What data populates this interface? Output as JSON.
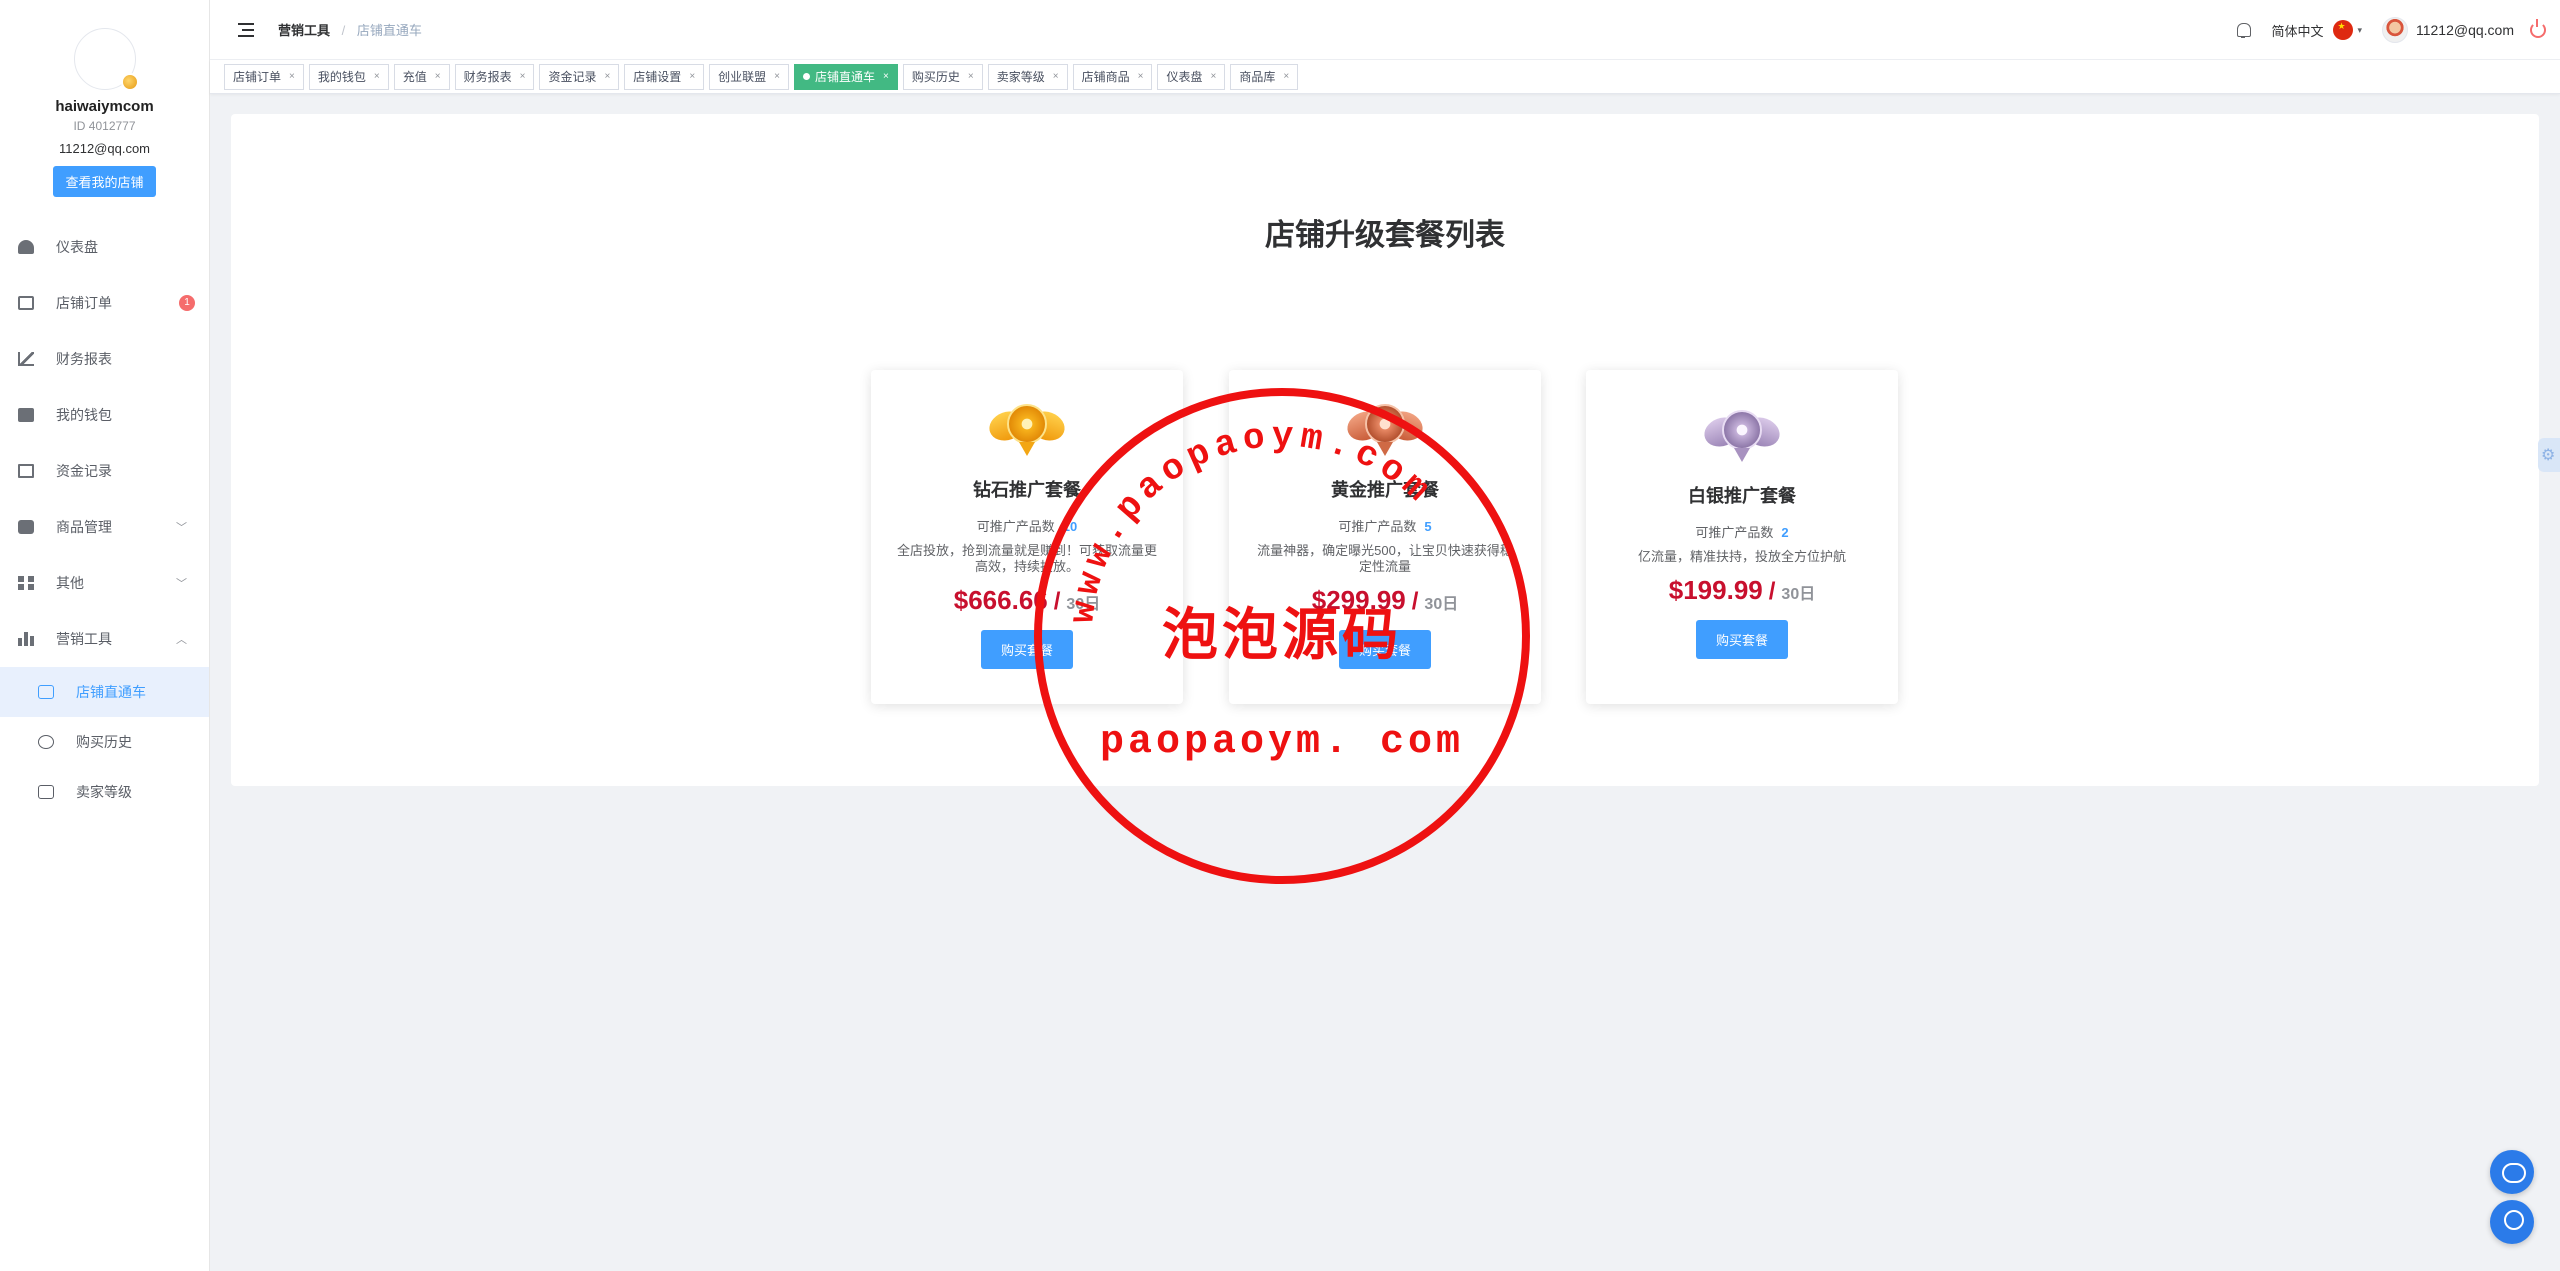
{
  "user": {
    "name": "haiwaiymcom",
    "id": "ID 4012777",
    "email": "11212@qq.com",
    "shop_button": "查看我的店铺"
  },
  "sidebar": {
    "items": [
      {
        "label": "仪表盘",
        "icon": "dashboard-icon"
      },
      {
        "label": "店铺订单",
        "icon": "clipboard-icon",
        "badge": "1"
      },
      {
        "label": "财务报表",
        "icon": "chart-icon"
      },
      {
        "label": "我的钱包",
        "icon": "wallet-icon"
      },
      {
        "label": "资金记录",
        "icon": "document-icon"
      },
      {
        "label": "商品管理",
        "icon": "bag-icon",
        "arrow": "﹀"
      },
      {
        "label": "其他",
        "icon": "grid-icon",
        "arrow": "﹀"
      },
      {
        "label": "营销工具",
        "icon": "bar-chart-icon",
        "arrow": "︿"
      }
    ],
    "sub_items": [
      {
        "label": "店铺直通车",
        "icon": "truck-icon"
      },
      {
        "label": "购买历史",
        "icon": "clock-icon"
      },
      {
        "label": "卖家等级",
        "icon": "upgrade-icon"
      }
    ]
  },
  "header": {
    "breadcrumb": [
      "营销工具",
      "店铺直通车"
    ],
    "breadcrumb_sep": "/",
    "language": "简体中文",
    "caret": "▾",
    "user_email": "11212@qq.com"
  },
  "tags": [
    {
      "label": "店铺订单",
      "active": false
    },
    {
      "label": "我的钱包",
      "active": false
    },
    {
      "label": "充值",
      "active": false
    },
    {
      "label": "财务报表",
      "active": false
    },
    {
      "label": "资金记录",
      "active": false
    },
    {
      "label": "店铺设置",
      "active": false
    },
    {
      "label": "创业联盟",
      "active": false
    },
    {
      "label": "店铺直通车",
      "active": true
    },
    {
      "label": "购买历史",
      "active": false
    },
    {
      "label": "卖家等级",
      "active": false
    },
    {
      "label": "店铺商品",
      "active": false
    },
    {
      "label": "仪表盘",
      "active": false
    },
    {
      "label": "商品库",
      "active": false
    }
  ],
  "tag_close": "×",
  "main": {
    "title": "店铺升级套餐列表",
    "cards": [
      {
        "medal": "gold-medal-icon",
        "title": "钻石推广套餐",
        "count_label": "可推广产品数",
        "count": "10",
        "desc": "全店投放，抢到流量就是赚到！可获取流量更高效，持续投放。",
        "price": "$666.66",
        "slash": "/",
        "period": "30日",
        "button": "购买套餐"
      },
      {
        "medal": "bronze-medal-icon",
        "title": "黄金推广套餐",
        "count_label": "可推广产品数",
        "count": "5",
        "desc": "流量神器，确定曝光500，让宝贝快速获得稳定性流量",
        "price": "$299.99",
        "slash": "/",
        "period": "30日",
        "button": "购买套餐"
      },
      {
        "medal": "silver-medal-icon",
        "title": "白银推广套餐",
        "count_label": "可推广产品数",
        "count": "2",
        "desc": "亿流量，精准扶持，投放全方位护航",
        "price": "$199.99",
        "slash": "/",
        "period": "30日",
        "button": "购买套餐"
      }
    ]
  },
  "watermark": {
    "arc_text": "www.paopaoym.com",
    "center_text": "泡泡源码",
    "bottom_text": "paopaoym. com",
    "color": "#ee1111"
  },
  "colors": {
    "primary": "#409eff",
    "active_tag": "#42b983",
    "price": "#c8102e"
  }
}
